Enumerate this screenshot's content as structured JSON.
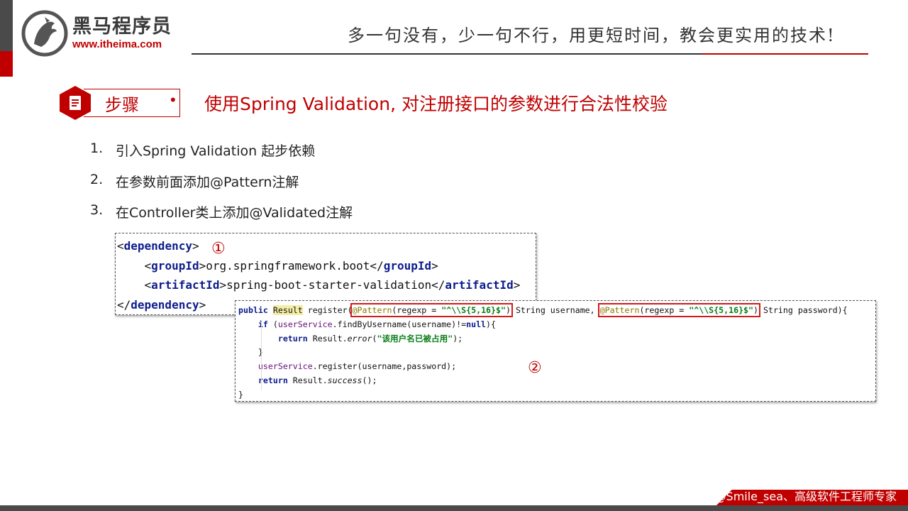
{
  "brand": {
    "name": "黑马程序员",
    "url": "www.itheima.com"
  },
  "header": {
    "slogan": "多一句没有，少一句不行，用更短时间，教会更实用的技术!"
  },
  "section": {
    "badge_label": "步骤",
    "bullet": "•",
    "title": "使用Spring Validation, 对注册接口的参数进行合法性校验"
  },
  "steps": [
    {
      "num": "1.",
      "text": "引入Spring  Validation 起步依赖"
    },
    {
      "num": "2.",
      "text": "在参数前面添加@Pattern注解"
    },
    {
      "num": "3.",
      "text": "在Controller类上添加@Validated注解"
    }
  ],
  "markers": {
    "first": "①",
    "second": "②"
  },
  "code_dependency": {
    "l1_open": "<",
    "l1_tag": "dependency",
    "l1_close": ">",
    "l2_indent": "    ",
    "l2_open": "<",
    "l2_tag": "groupId",
    "l2_mid": ">org.springframework.boot</",
    "l2_tag2": "groupId",
    "l2_end": ">",
    "l3_indent": "    ",
    "l3_open": "<",
    "l3_tag": "artifactId",
    "l3_mid": ">spring-boot-starter-validation</",
    "l3_tag2": "artifactId",
    "l3_end": ">",
    "l4_open": "</",
    "l4_tag": "dependency",
    "l4_close": ">"
  },
  "code_method": {
    "public": "public ",
    "result": "Result",
    "register": " register(",
    "pattern1_ann": "@Pattern",
    "pattern1_pre": "(regexp = ",
    "pattern1_str": "\"^\\\\S{5,16}$\"",
    "pattern1_post": ")",
    "mid": " String username, ",
    "pattern2_ann": "@Pattern",
    "pattern2_pre": "(regexp = ",
    "pattern2_str": "\"^\\\\S{5,16}$\"",
    "pattern2_post": ")",
    "tail": " String password){",
    "if_indent": "    ",
    "if_kw": "if",
    "if_pre": " (",
    "if_field": "userService",
    "if_mid": ".findByUsername(username)!=",
    "if_null": "null",
    "if_end": "){",
    "ret1_indent": "        ",
    "ret1_kw": "return",
    "ret1_pre": " Result.",
    "ret1_method": "error",
    "ret1_open": "(",
    "ret1_str": "\"该用户名已被占用\"",
    "ret1_end": ");",
    "close_if_indent": "    ",
    "close_if": "}",
    "reg_indent": "    ",
    "reg_field": "userService",
    "reg_rest": ".register(username,password);",
    "ret2_indent": "    ",
    "ret2_kw": "return",
    "ret2_pre": " Result.",
    "ret2_method": "success",
    "ret2_end": "();",
    "close_method": "}"
  },
  "footer": {
    "text": "CSDN @Smile_sea、高级软件工程师专家"
  },
  "colors": {
    "accent": "#c00000",
    "dark": "#4a4a4a",
    "keyword": "#0d1c8c",
    "string": "#067d17",
    "highlight": "#f5eea6"
  }
}
